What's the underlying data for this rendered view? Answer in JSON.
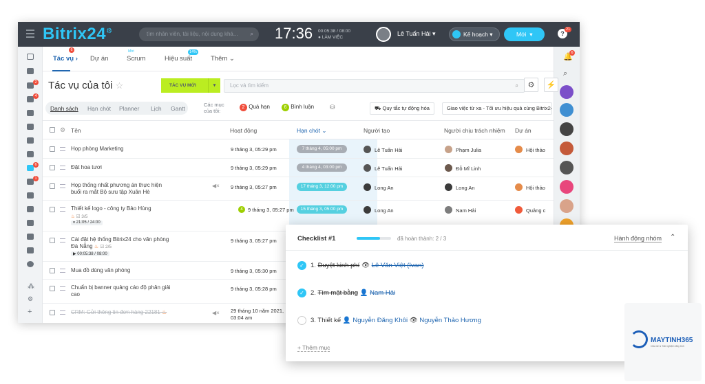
{
  "topbar": {
    "logo_main": "Bitrix",
    "logo_num": "24",
    "search_placeholder": "tìm nhân viên, tài liệu, nội dung khá...",
    "time": "17:36",
    "worktime": "00:05:38 / 08:00",
    "work_status": "LÀM VIỆC",
    "username": "Lê Tuấn Hải",
    "plan_label": "Kế hoạch",
    "new_label": "Mới",
    "help": "?",
    "help_badge": "21"
  },
  "tabs": [
    {
      "label": "Tác vụ",
      "badge": "6"
    },
    {
      "label": "Dự án"
    },
    {
      "label": "Scrum",
      "tag": "Mới"
    },
    {
      "label": "Hiệu suất",
      "tag": "14%"
    },
    {
      "label": "Thêm"
    }
  ],
  "header": {
    "title": "Tác vụ của tôi",
    "new_task": "TÁC VỤ MỚI",
    "filter_placeholder": "Lọc và tìm kiếm"
  },
  "views": {
    "list": "Danh sách",
    "deadline": "Hạn chót",
    "planner": "Planner",
    "calendar": "Lịch",
    "gantt": "Gantt",
    "items_label_1": "Các mục",
    "items_label_2": "của tôi:",
    "overdue_count": "2",
    "overdue": "Quá hạn",
    "comments_count": "6",
    "comments": "Bình luận",
    "rules": "Quy tắc tự động hóa",
    "remote": "Giao việc từ xa - Tối ưu hiệu quả cùng Bitrix24"
  },
  "columns": [
    "Tên",
    "Hoạt động",
    "Hạn chót",
    "Người tạo",
    "Người chịu trách nhiệm",
    "Dự án"
  ],
  "rows": [
    {
      "name": "Họp phòng Marketing",
      "activity": "9 tháng 3, 05:29 pm",
      "deadline": "7 tháng 4, 05:00 pm",
      "dl_color": "#a8adb4",
      "creator": "Lê Tuấn Hải",
      "responsible": "Phạm Julia",
      "project": "Hội thảo"
    },
    {
      "name": "Đặt hoa tươi",
      "activity": "9 tháng 3, 05:29 pm",
      "deadline": "4 tháng 4, 03:00 pm",
      "dl_color": "#a8adb4",
      "creator": "Lê Tuấn Hải",
      "responsible": "Đỗ Mĩ Linh",
      "project": ""
    },
    {
      "name": "Họp thống nhất phương án thực hiện",
      "name2": "buổi ra mắt Bộ sưu tập Xuân Hè",
      "activity": "9 tháng 3, 05:27 pm",
      "deadline": "17 tháng 3, 12:00 pm",
      "dl_color": "#55d0e0",
      "creator": "Long An",
      "responsible": "Long An",
      "project": "Hội thảo"
    },
    {
      "name": "Thiết kế logo - công ty Bảo Hùng",
      "sub": "3/5",
      "timer": "21:05 / 24:00",
      "badge": "4",
      "activity": "9 tháng 3, 05:27 pm",
      "deadline": "15 tháng 3, 05:00 pm",
      "dl_color": "#55d0e0",
      "creator": "Long An",
      "responsible": "Nam Hải",
      "project": "Quảng c"
    },
    {
      "name": "Cài đặt hệ thống Bitrix24 cho văn phòng",
      "name2": "Đà Nẵng",
      "sub": "2/5",
      "timer": "00:05:38 / 08:00",
      "activity": "9 tháng 3, 05:27 pm"
    },
    {
      "name": "Mua đồ dùng văn phòng",
      "activity": "9 tháng 3, 05:30 pm"
    },
    {
      "name": "Chuẩn bị banner quảng cáo độ phân giải",
      "name2": "cao",
      "activity": "9 tháng 3, 05:28 pm"
    },
    {
      "name": "CRM: Gửi thông tin đơn hàng 22181",
      "activity": "29 tháng 10 năm 2021,",
      "activity2": "03:04 am"
    }
  ],
  "checklist": {
    "title": "Checklist #1",
    "progress_label": "đã hoàn thành: 2 / 3",
    "progress": 0.67,
    "group_action": "Hành động nhóm",
    "add": "+ Thêm mục",
    "items": [
      {
        "num": "1.",
        "text": "Duyệt kinh phí",
        "person": "Lê Văn Việt (Ivan)",
        "done": true
      },
      {
        "num": "2.",
        "text": "Tìm mặt bằng",
        "person": "Nam Hải",
        "done": true
      },
      {
        "num": "3.",
        "text": "Thiết kế",
        "person": "Nguyễn Đăng Khôi",
        "person2": "Nguyễn Thảo Hương",
        "done": false
      }
    ]
  },
  "watermark": {
    "brand": "MAYTINH365",
    "tagline": "Chia sẻ & Trải nghiệm Máy tính"
  },
  "colors": {
    "accent": "#2fc6f6",
    "green": "#bbed21",
    "dark": "#3a4049",
    "link": "#2066b0"
  }
}
